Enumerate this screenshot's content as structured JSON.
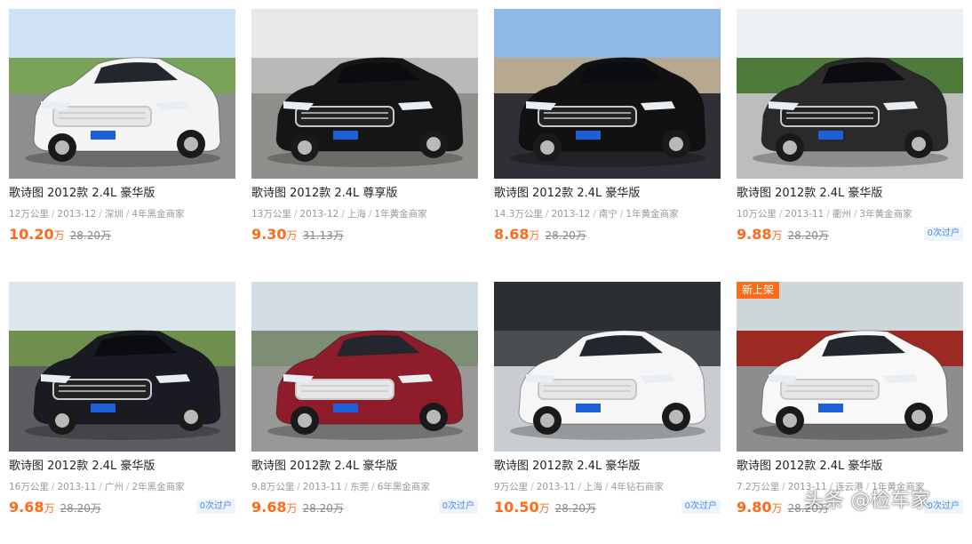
{
  "listings": [
    {
      "title": "歌诗图 2012款 2.4L 豪华版",
      "mileage": "12万公里",
      "date": "2013-12",
      "city": "深圳",
      "dealer": "4年黑金商家",
      "price": "10.20",
      "unit": "万",
      "original": "28.20万",
      "transfer": "",
      "new_badge": "",
      "car_color": "#f4f4f4",
      "scene": "outdoor"
    },
    {
      "title": "歌诗图 2012款 2.4L 尊享版",
      "mileage": "13万公里",
      "date": "2013-12",
      "city": "上海",
      "dealer": "1年黄金商家",
      "price": "9.30",
      "unit": "万",
      "original": "31.13万",
      "transfer": "",
      "new_badge": "",
      "car_color": "#151515",
      "scene": "street"
    },
    {
      "title": "歌诗图 2012款 2.4L 豪华版",
      "mileage": "14.3万公里",
      "date": "2013-12",
      "city": "南宁",
      "dealer": "1年黄金商家",
      "price": "8.68",
      "unit": "万",
      "original": "28.20万",
      "transfer": "",
      "new_badge": "",
      "car_color": "#111111",
      "scene": "city"
    },
    {
      "title": "歌诗图 2012款 2.4L 豪华版",
      "mileage": "10万公里",
      "date": "2013-11",
      "city": "衢州",
      "dealer": "3年黄金商家",
      "price": "9.88",
      "unit": "万",
      "original": "28.20万",
      "transfer": "0次过户",
      "new_badge": "",
      "car_color": "#2a2a2a",
      "scene": "park"
    },
    {
      "title": "歌诗图 2012款 2.4L 豪华版",
      "mileage": "16万公里",
      "date": "2013-11",
      "city": "广州",
      "dealer": "2年黑金商家",
      "price": "9.68",
      "unit": "万",
      "original": "28.20万",
      "transfer": "0次过户",
      "new_badge": "",
      "car_color": "#1a1a22",
      "scene": "road"
    },
    {
      "title": "歌诗图 2012款 2.4L 豪华版",
      "mileage": "9.8万公里",
      "date": "2013-11",
      "city": "东莞",
      "dealer": "6年黑金商家",
      "price": "9.68",
      "unit": "万",
      "original": "28.20万",
      "transfer": "0次过户",
      "new_badge": "",
      "car_color": "#8e1c2a",
      "scene": "lot"
    },
    {
      "title": "歌诗图 2012款 2.4L 豪华版",
      "mileage": "9万公里",
      "date": "2013-11",
      "city": "上海",
      "dealer": "4年钻石商家",
      "price": "10.50",
      "unit": "万",
      "original": "28.20万",
      "transfer": "0次过户",
      "new_badge": "",
      "car_color": "#f6f6f6",
      "scene": "showroom"
    },
    {
      "title": "歌诗图 2012款 2.4L 豪华版",
      "mileage": "7.2万公里",
      "date": "2013-11",
      "city": "连云港",
      "dealer": "1年黄金商家",
      "price": "9.80",
      "unit": "万",
      "original": "28.20万",
      "transfer": "0次过户",
      "new_badge": "新上架",
      "car_color": "#f8f8f8",
      "scene": "wet"
    }
  ],
  "watermark": "头条 @检车家",
  "colors": {
    "price": "#ff6a1a",
    "transfer_text": "#4a8be0",
    "transfer_bg": "#eef4fd",
    "new_badge_bg": "#ff6a1a"
  },
  "icons": {
    "photo": "car-photo"
  }
}
